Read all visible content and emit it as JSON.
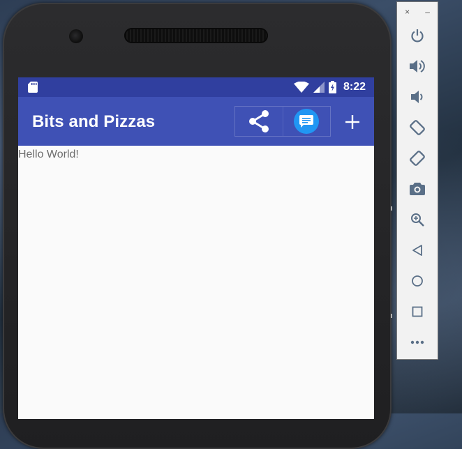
{
  "status_bar": {
    "time": "8:22"
  },
  "app_bar": {
    "title": "Bits and Pizzas"
  },
  "content": {
    "text": "Hello World!"
  },
  "emulator_panel": {
    "close": "×",
    "minimize": "–"
  },
  "colors": {
    "status_bar": "#303f9f",
    "app_bar": "#3f51b5",
    "message_icon_bg": "#2196f3",
    "panel_icon": "#5a6f87"
  }
}
